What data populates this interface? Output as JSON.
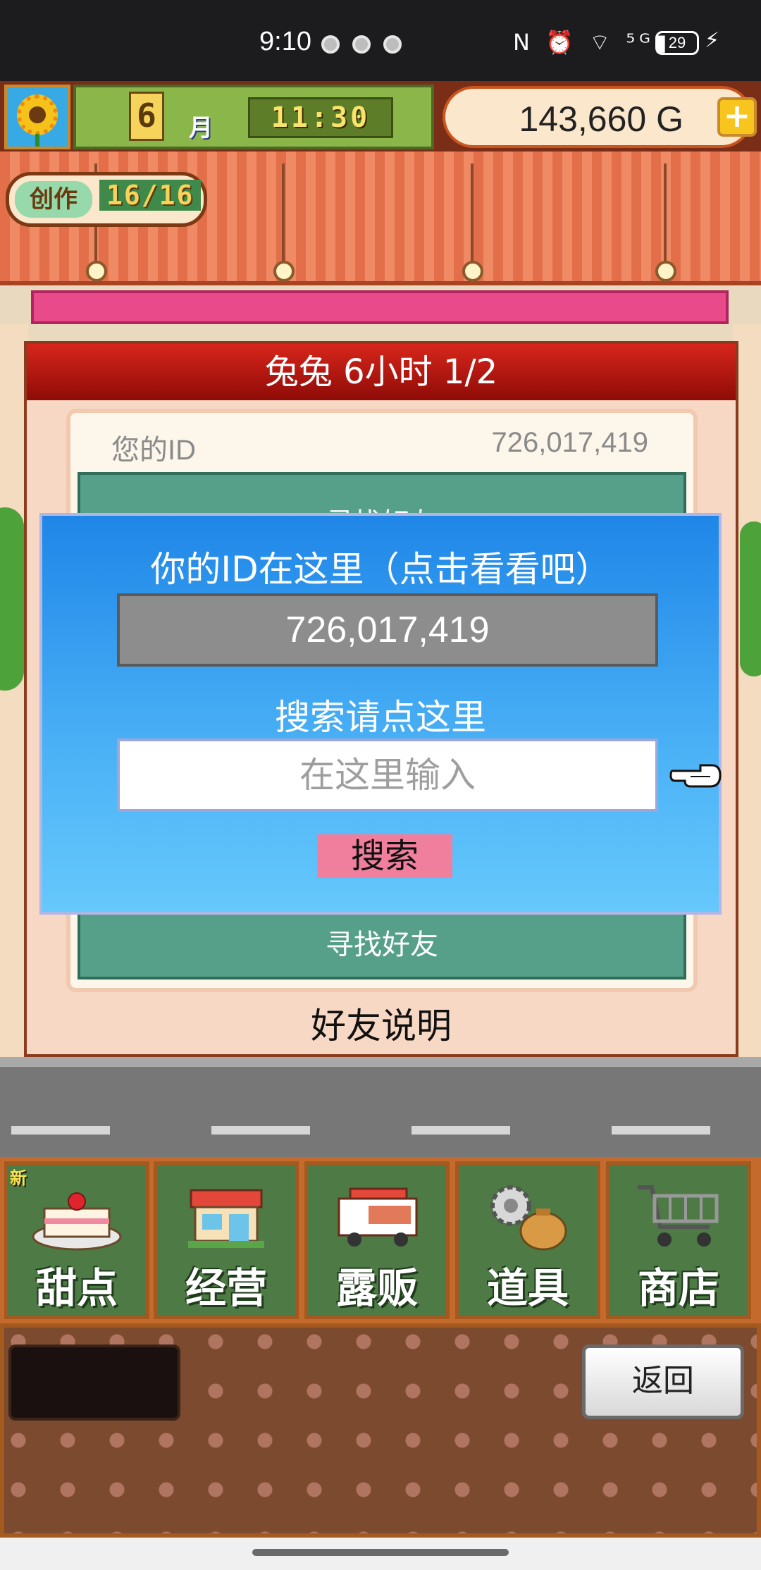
{
  "status_bar": {
    "time": "9:10",
    "icons_text": "N ⏰ ⌔ ⁵ᴳ▮",
    "battery": "29"
  },
  "game_header": {
    "month_number": "6",
    "month_label": "月",
    "clock": "11:30",
    "money": "143,660 G",
    "plus_symbol": "+",
    "create_label": "创作",
    "create_count": "16/16"
  },
  "friends_panel": {
    "title": "兔兔  6小时 1/2",
    "your_id_label": "您的ID",
    "your_id_value": "726,017,419",
    "teal_top_text": "寻找好友",
    "teal_bottom_text": "寻找好友",
    "explain_label": "好友说明"
  },
  "id_dialog": {
    "title": "你的ID在这里（点击看看吧）",
    "id_value": "726,017,419",
    "search_label": "搜索请点这里",
    "input_placeholder": "在这里输入",
    "search_button": "搜索"
  },
  "menu": {
    "new_badge": "新",
    "items": [
      {
        "label": "甜点",
        "icon": "cake-icon"
      },
      {
        "label": "经营",
        "icon": "shop-icon"
      },
      {
        "label": "露贩",
        "icon": "food-truck-icon"
      },
      {
        "label": "道具",
        "icon": "gear-bag-icon"
      },
      {
        "label": "商店",
        "icon": "shopping-cart-icon"
      }
    ]
  },
  "bottom_bar": {
    "back_button": "返回"
  },
  "colors": {
    "dialog_top": "#1f86e8",
    "dialog_bottom": "#66c8fb",
    "panel_title": "#c01a12",
    "search_button": "#f07e9d",
    "menu_tile": "#4d7a45"
  }
}
